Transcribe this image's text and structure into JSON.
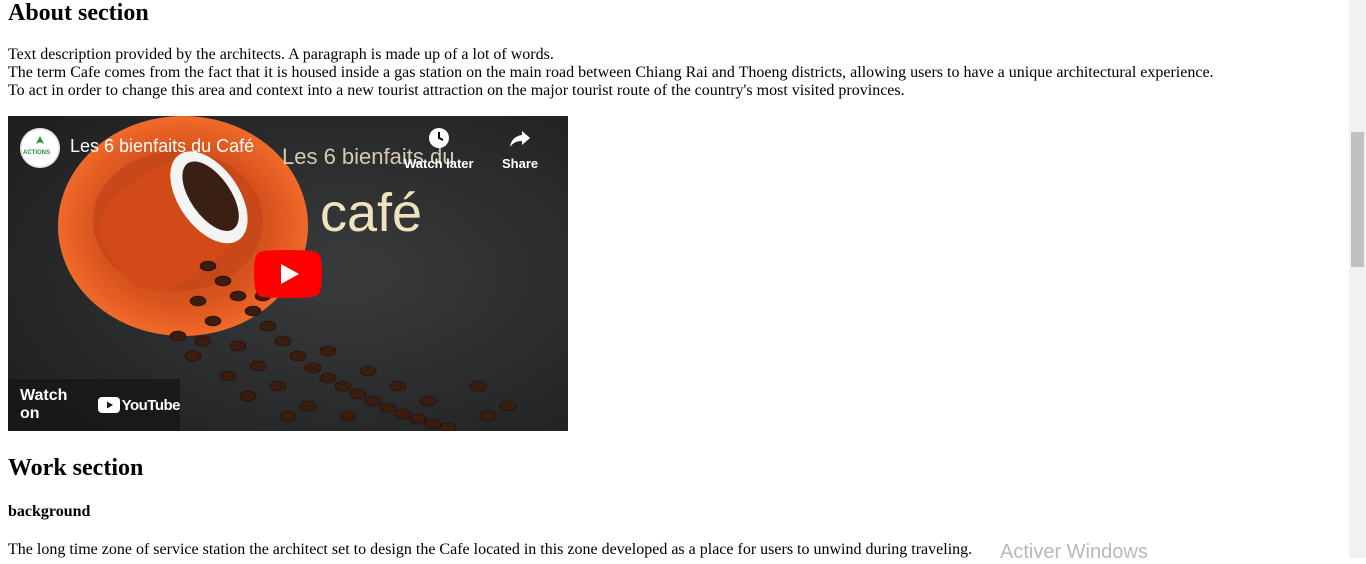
{
  "about": {
    "title": "About section",
    "lines": [
      "Text description provided by the architects. A paragraph is made up of a lot of words.",
      "The term Cafe comes from the fact that it is housed inside a gas station on the main road between Chiang Rai and Thoeng districts, allowing users to have a unique architectural experience.",
      "To act in order to change this area and context into a new tourist attraction on the major tourist route of the country's most visited provinces."
    ]
  },
  "video": {
    "title": "Les 6 bienfaits du Café",
    "channel_logo_text": "ACTIONS",
    "thumb_line1": "Les 6 bienfaits du",
    "thumb_line2": "café",
    "watch_later": "Watch later",
    "share": "Share",
    "watch_on": "Watch on",
    "youtube": "YouTube"
  },
  "work": {
    "title": "Work section",
    "subtitle": "background",
    "text": "The long time zone of service station the architect set to design the Cafe located in this zone developed as a place for users to unwind during traveling."
  },
  "watermark": "Activer Windows",
  "colors": {
    "youtube_red": "#ff0000",
    "saucer_orange": "#d9531e"
  }
}
